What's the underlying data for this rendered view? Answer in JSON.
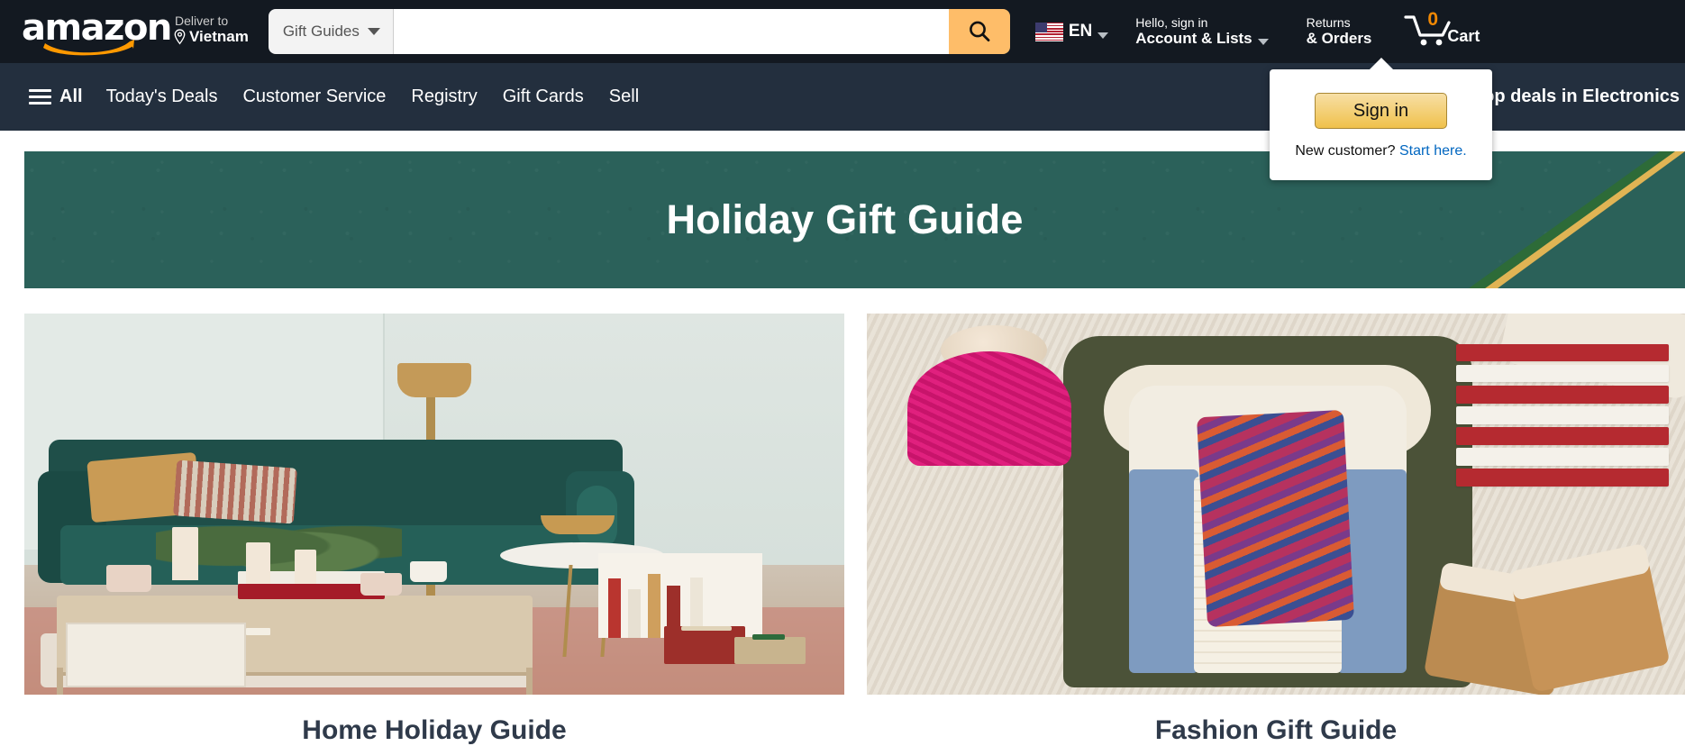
{
  "header": {
    "logo_text": "amazon",
    "logo_icon": "amazon-smile-logo",
    "deliver": {
      "line1": "Deliver to",
      "line2": "Vietnam",
      "icon": "location-pin-icon"
    },
    "search": {
      "category_label": "Gift Guides",
      "category_icon": "chevron-down-icon",
      "value": "",
      "placeholder": "",
      "button_icon": "search-icon",
      "button_color": "#febd69"
    },
    "language": {
      "label": "EN",
      "flag_icon": "us-flag-icon",
      "caret_icon": "chevron-down-icon"
    },
    "account": {
      "line1": "Hello, sign in",
      "line2": "Account & Lists",
      "caret_icon": "chevron-down-icon"
    },
    "returns": {
      "line1": "Returns",
      "line2": "& Orders"
    },
    "cart": {
      "count": "0",
      "label": "Cart",
      "icon": "shopping-cart-icon",
      "count_color": "#f08804"
    },
    "background_color": "#131921"
  },
  "nav": {
    "all_label": "All",
    "all_icon": "hamburger-menu-icon",
    "items": [
      {
        "label": "Today's Deals"
      },
      {
        "label": "Customer Service"
      },
      {
        "label": "Registry"
      },
      {
        "label": "Gift Cards"
      },
      {
        "label": "Sell"
      }
    ],
    "promo": "Shop deals in Electronics",
    "background_color": "#232f3e"
  },
  "signin_flyout": {
    "button_label": "Sign in",
    "new_customer_text": "New customer?",
    "start_here_link": "Start here.",
    "link_color": "#0066c0"
  },
  "banner": {
    "title": "Holiday Gift Guide",
    "background_color": "#2b615a",
    "accent_color": "#e0b454"
  },
  "cards": [
    {
      "caption": "Home Holiday Guide",
      "image_name": "living-room-holiday-scene"
    },
    {
      "caption": "Fashion Gift Guide",
      "image_name": "winter-fashion-flatlay"
    }
  ]
}
